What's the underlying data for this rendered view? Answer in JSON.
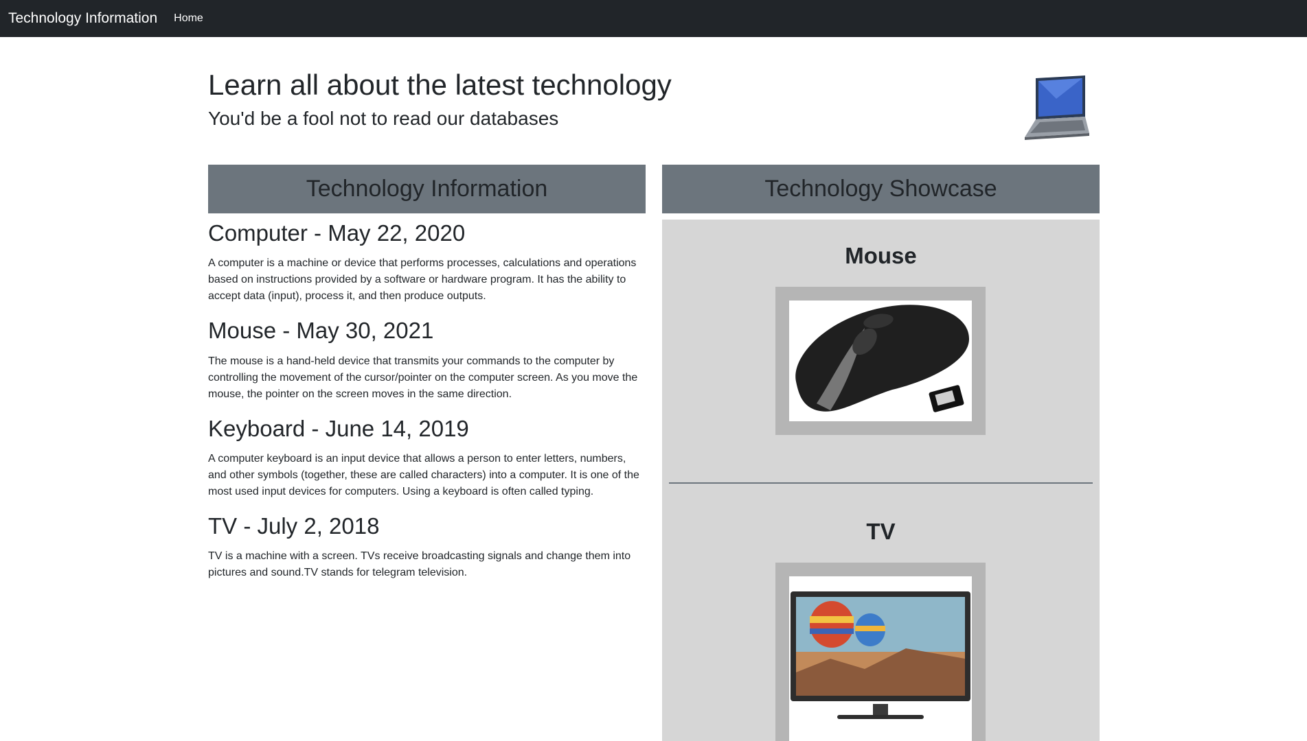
{
  "navbar": {
    "brand": "Technology Information",
    "home": "Home"
  },
  "hero": {
    "title": "Learn all about the latest technology",
    "subtitle": "You'd be a fool not to read our databases",
    "image_icon": "laptop-icon"
  },
  "columns": {
    "left_header": "Technology Information",
    "right_header": "Technology Showcase"
  },
  "articles": [
    {
      "title": "Computer - May 22, 2020",
      "body": "A computer is a machine or device that performs processes, calculations and operations based on instructions provided by a software or hardware program. It has the ability to accept data (input), process it, and then produce outputs."
    },
    {
      "title": "Mouse - May 30, 2021",
      "body": "The mouse is a hand-held device that transmits your commands to the computer by controlling the movement of the cursor/pointer on the computer screen. As you move the mouse, the pointer on the screen moves in the same direction."
    },
    {
      "title": "Keyboard - June 14, 2019",
      "body": "A computer keyboard is an input device that allows a person to enter letters, numbers, and other symbols (together, these are called characters) into a computer. It is one of the most used input devices for computers. Using a keyboard is often called typing."
    },
    {
      "title": "TV - July 2, 2018",
      "body": "TV is a machine with a screen. TVs receive broadcasting signals and change them into pictures and sound.TV stands for telegram television."
    }
  ],
  "showcase": [
    {
      "title": "Mouse",
      "image_icon": "mouse-image"
    },
    {
      "title": "TV",
      "image_icon": "tv-image"
    }
  ]
}
